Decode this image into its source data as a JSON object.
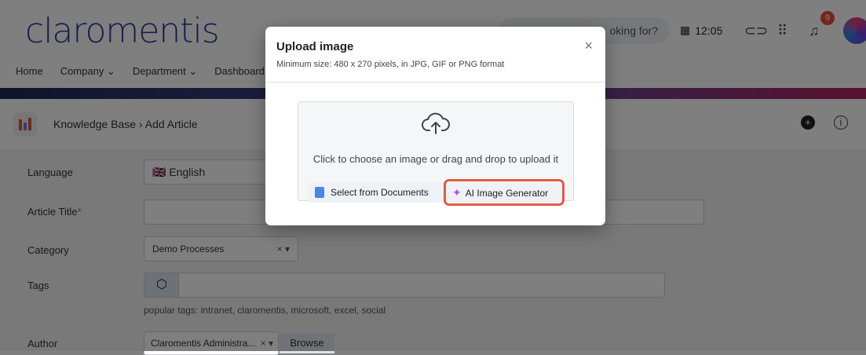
{
  "header": {
    "logo": "claromentis",
    "nav": [
      "Home",
      "Company ⌄",
      "Department ⌄",
      "Dashboard"
    ],
    "search_placeholder": "oking for?",
    "time": "12:05",
    "notification_count": "9"
  },
  "breadcrumb": {
    "text": "Knowledge Base › Add Article"
  },
  "form": {
    "language_label": "Language",
    "language_value": "🇬🇧 English",
    "title_label": "Article Title",
    "required_mark": "*",
    "category_label": "Category",
    "category_value": "Demo Processes",
    "category_clear": "× ▾",
    "tags_label": "Tags",
    "tags_hint": "popular tags: intranet,  claromentis,  microsoft,  excel,  social",
    "author_label": "Author",
    "author_value": "Claromentis Administra...",
    "author_clear": "× ▾",
    "browse": "Browse"
  },
  "modal": {
    "title": "Upload image",
    "subtitle": "Minimum size: 480 x 270 pixels, in JPG, GIF or PNG format",
    "close": "×",
    "drop_text": "Click to choose an image or drag and drop to upload it",
    "select_docs": "Select from Documents",
    "ai_generator": "AI Image Generator"
  },
  "colors": {
    "logo": "#2f3f93",
    "highlight": "#e15b46",
    "badge": "#e74c3c"
  }
}
